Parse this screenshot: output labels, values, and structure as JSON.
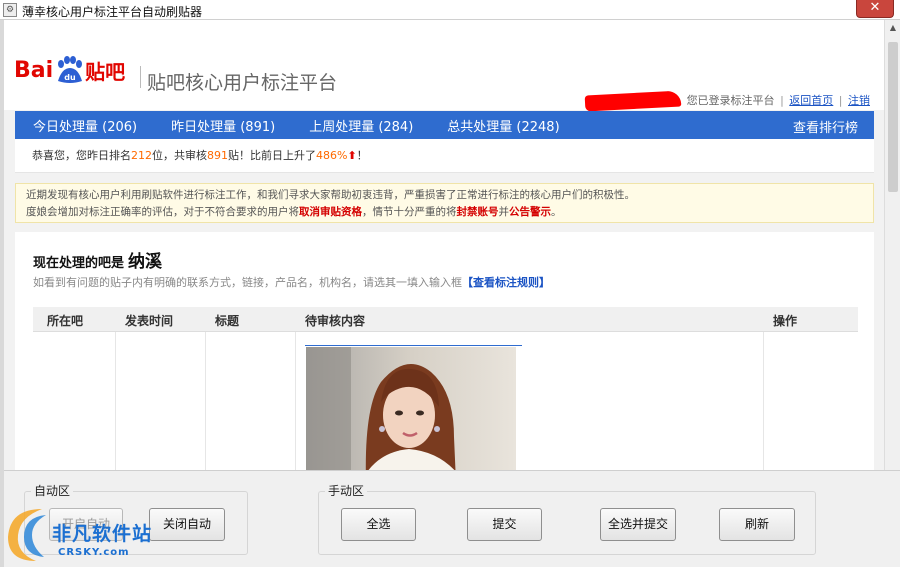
{
  "window": {
    "title": "薄幸核心用户标注平台自动刷贴器",
    "close_label": "✕"
  },
  "header": {
    "logo_bai": "Bai",
    "logo_du": "du",
    "logo_tieba": "贴吧",
    "platform_title": "贴吧核心用户标注平台",
    "login_status": "您已登录标注平台",
    "home_link": "返回首页",
    "logout_link": "注销"
  },
  "nav": {
    "items": [
      {
        "label": "今日处理量 (206)"
      },
      {
        "label": "昨日处理量 (891)"
      },
      {
        "label": "上周处理量 (284)"
      },
      {
        "label": "总共处理量 (2248)"
      }
    ],
    "ranking_label": "查看排行榜"
  },
  "rank": {
    "prefix": "恭喜您，您昨日排名",
    "rank_value": "212",
    "mid1": "位，共审核",
    "reviewed": "891",
    "mid2": "贴！比前日上升了",
    "percent": "486%",
    "suffix": "！"
  },
  "notice": {
    "line1": "近期发现有核心用户利用刷贴软件进行标注工作，和我们寻求大家帮助初衷违背，严重损害了正常进行标注的核心用户们的积极性。",
    "line2_a": "度娘会增加对标注正确率的评估，对于不符合要求的用户将",
    "line2_red1": "取消审贴资格",
    "line2_b": "，情节十分严重的将",
    "line2_red2": "封禁账号",
    "line2_c": "并",
    "line2_red3": "公告警示",
    "line2_d": "。"
  },
  "content": {
    "current_label": "现在处理的吧是",
    "bar_name": "纳溪",
    "hint": "如看到有问题的贴子内有明确的联系方式，链接，产品名，机构名，请选其一填入输入框",
    "rule_link": "【查看标注规则】",
    "columns": [
      "所在吧",
      "发表时间",
      "标题",
      "待审核内容",
      "操作"
    ]
  },
  "bottom": {
    "auto_group": "自动区",
    "start_auto": "开启自动",
    "stop_auto": "关闭自动",
    "manual_group": "手动区",
    "select_all": "全选",
    "submit": "提交",
    "select_submit": "全选并提交",
    "refresh": "刷新"
  },
  "watermark": {
    "text": "非凡软件站",
    "sub": "CRSKY.com"
  },
  "colors": {
    "nav_blue": "#2f6ccf",
    "baidu_red": "#e10601",
    "highlight_orange": "#ff6a00"
  }
}
